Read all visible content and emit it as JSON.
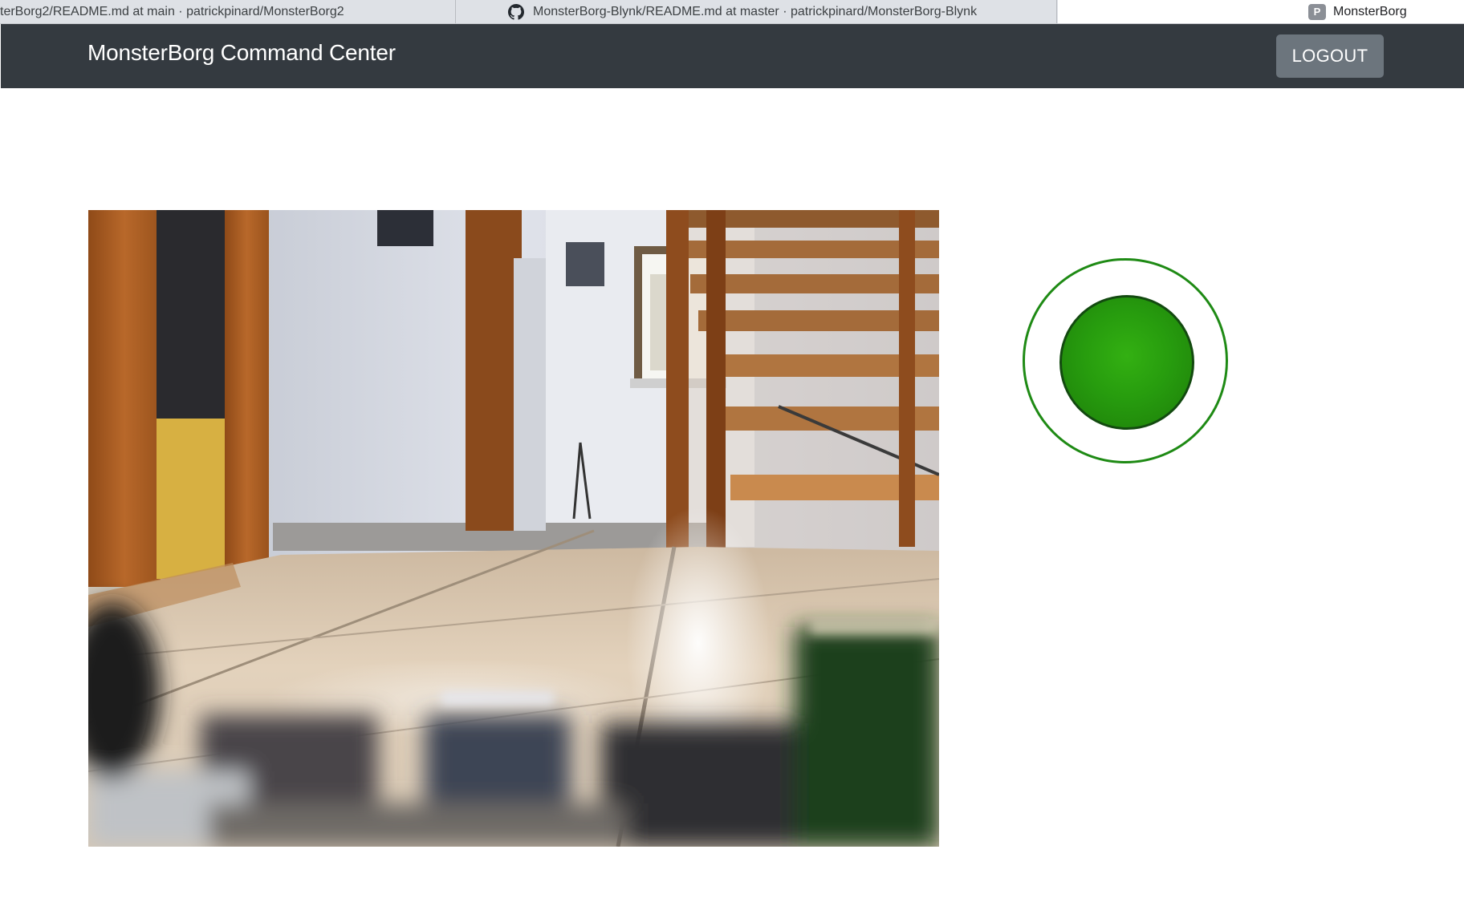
{
  "browser": {
    "tabs": [
      {
        "title": "terBorg2/README.md at main · patrickpinard/MonsterBorg2",
        "icon": ""
      },
      {
        "title": "MonsterBorg-Blynk/README.md at master · patrickpinard/MonsterBorg-Blynk",
        "icon": "github-icon"
      },
      {
        "title": "MonsterBorg",
        "icon": "P"
      }
    ]
  },
  "navbar": {
    "brand": "MonsterBorg Command Center",
    "logout_label": "LOGOUT"
  },
  "colors": {
    "navbar_bg": "#343a40",
    "button_bg": "#6c757d",
    "joystick_ring": "#1e8a14",
    "joystick_knob": "#279c0e"
  },
  "joystick": {
    "position_x": 0,
    "position_y": 0
  }
}
